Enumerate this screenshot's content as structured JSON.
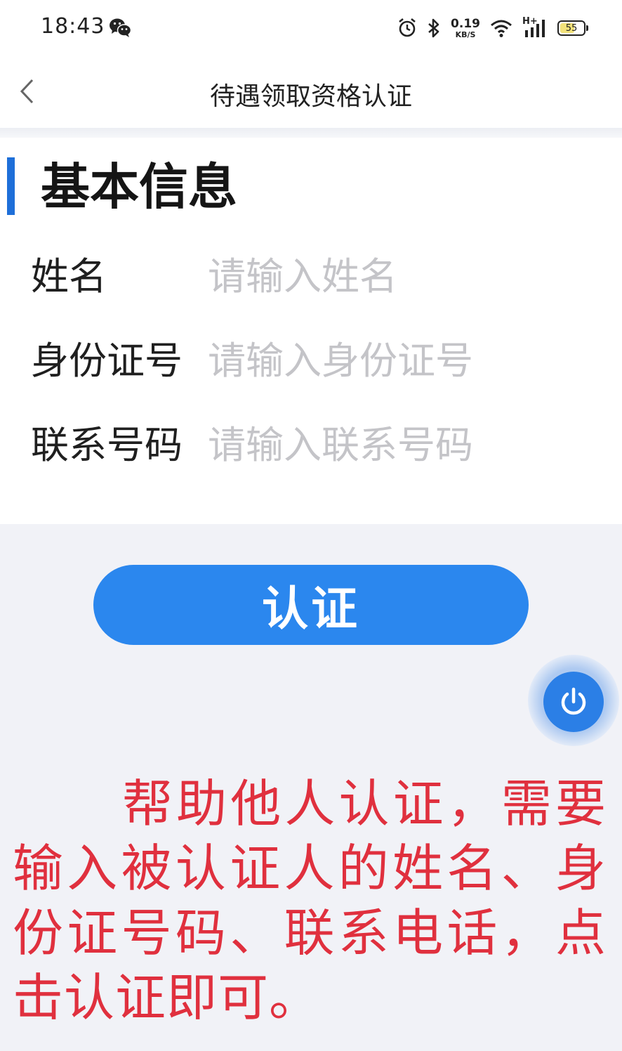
{
  "status_bar": {
    "time": "18:43",
    "net_speed_value": "0.19",
    "net_speed_unit": "KB/S",
    "network_label": "H+",
    "battery_level": "55",
    "icons": [
      "wechat-icon",
      "alarm-icon",
      "bluetooth-icon",
      "wifi-icon",
      "signal-icon",
      "battery-icon"
    ]
  },
  "nav": {
    "title": "待遇领取资格认证"
  },
  "form": {
    "section_title": "基本信息",
    "fields": [
      {
        "label": "姓名",
        "placeholder": "请输入姓名",
        "value": ""
      },
      {
        "label": "身份证号",
        "placeholder": "请输入身份证号",
        "value": ""
      },
      {
        "label": "联系号码",
        "placeholder": "请输入联系号码",
        "value": ""
      }
    ],
    "submit_label": "认证"
  },
  "colors": {
    "accent": "#2b87ee",
    "section_bar": "#1e6fd9",
    "caption": "#e0303e",
    "placeholder": "#c4c4c8"
  },
  "annotation": {
    "text": "帮助他人认证，需要输入被认证人的姓名、身份证号码、联系电话，点击认证即可。"
  }
}
